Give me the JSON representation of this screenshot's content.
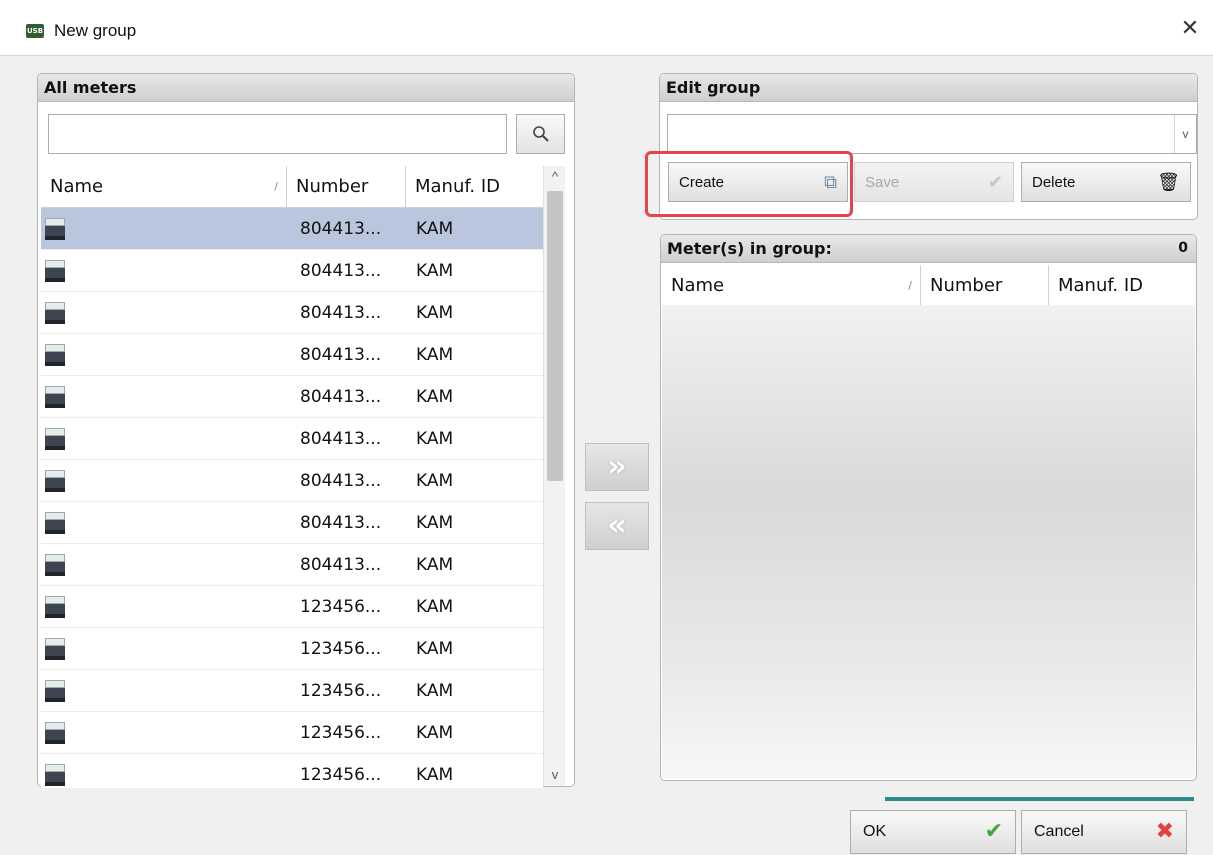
{
  "window": {
    "title": "New group",
    "app_icon_text": "USB"
  },
  "all_meters": {
    "header": "All meters",
    "search": {
      "value": "",
      "placeholder": ""
    },
    "columns": [
      "Name",
      "Number",
      "Manuf. ID"
    ],
    "rows": [
      {
        "name": "",
        "number": "804413...",
        "manuf_id": "KAM",
        "selected": true
      },
      {
        "name": "",
        "number": "804413...",
        "manuf_id": "KAM"
      },
      {
        "name": "",
        "number": "804413...",
        "manuf_id": "KAM"
      },
      {
        "name": "",
        "number": "804413...",
        "manuf_id": "KAM"
      },
      {
        "name": "",
        "number": "804413...",
        "manuf_id": "KAM"
      },
      {
        "name": "",
        "number": "804413...",
        "manuf_id": "KAM"
      },
      {
        "name": "",
        "number": "804413...",
        "manuf_id": "KAM"
      },
      {
        "name": "",
        "number": "804413...",
        "manuf_id": "KAM"
      },
      {
        "name": "",
        "number": "804413...",
        "manuf_id": "KAM"
      },
      {
        "name": "",
        "number": "123456...",
        "manuf_id": "KAM"
      },
      {
        "name": "",
        "number": "123456...",
        "manuf_id": "KAM"
      },
      {
        "name": "",
        "number": "123456...",
        "manuf_id": "KAM"
      },
      {
        "name": "",
        "number": "123456...",
        "manuf_id": "KAM"
      },
      {
        "name": "",
        "number": "123456...",
        "manuf_id": "KAM"
      }
    ]
  },
  "transfer": {
    "add_glyph": "»",
    "remove_glyph": "«"
  },
  "edit_group": {
    "header": "Edit group",
    "combo_value": "",
    "create_label": "Create",
    "save_label": "Save",
    "delete_label": "Delete"
  },
  "meters_in_group": {
    "header": "Meter(s) in group:",
    "count": "0",
    "columns": [
      "Name",
      "Number",
      "Manuf. ID"
    ]
  },
  "footer": {
    "ok_label": "OK",
    "cancel_label": "Cancel"
  },
  "colors": {
    "selection": "#b9c6de",
    "highlight": "#e8434b",
    "accent": "#2e8b8b"
  }
}
